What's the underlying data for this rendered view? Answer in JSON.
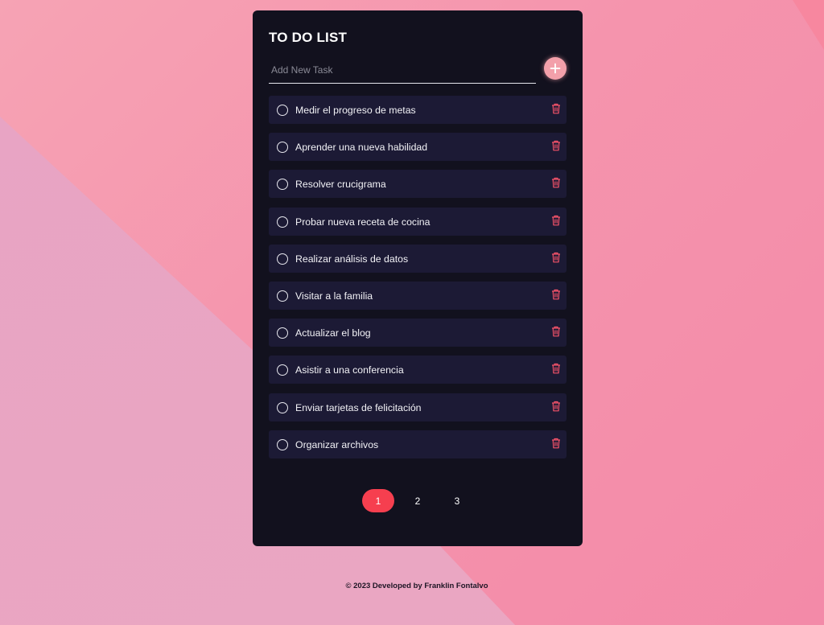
{
  "app": {
    "title": "TO DO LIST",
    "input_placeholder": "Add New Task",
    "add_icon": "plus-icon",
    "accent_color": "#f63f4f",
    "card_color": "#12111e",
    "task_bg_color": "#1c1a35"
  },
  "tasks": [
    {
      "label": "Medir el progreso de metas",
      "done": false
    },
    {
      "label": "Aprender una nueva habilidad",
      "done": false
    },
    {
      "label": "Resolver crucigrama",
      "done": false
    },
    {
      "label": "Probar nueva receta de cocina",
      "done": false
    },
    {
      "label": "Realizar análisis de datos",
      "done": false
    },
    {
      "label": "Visitar a la familia",
      "done": false
    },
    {
      "label": "Actualizar el blog",
      "done": false
    },
    {
      "label": "Asistir a una conferencia",
      "done": false
    },
    {
      "label": "Enviar tarjetas de felicitación",
      "done": false
    },
    {
      "label": "Organizar archivos",
      "done": false
    }
  ],
  "pagination": {
    "pages": [
      "1",
      "2",
      "3"
    ],
    "current": "1"
  },
  "footer": {
    "text": "© 2023 Developed by Franklin Fontalvo"
  }
}
